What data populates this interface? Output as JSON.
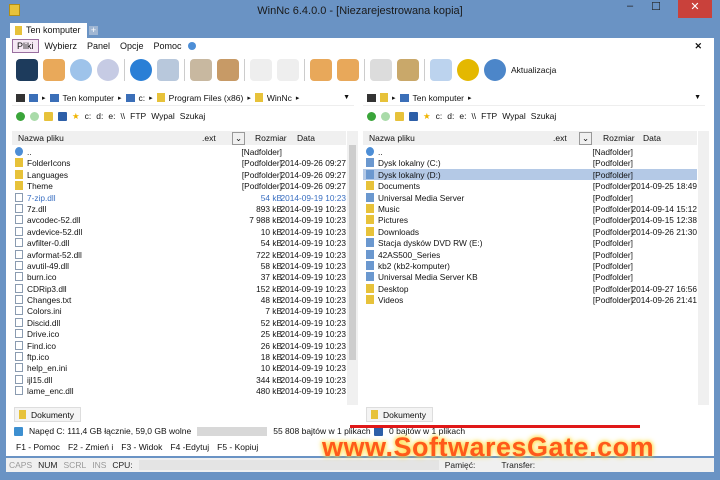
{
  "window": {
    "title": "WinNc 6.4.0.0 - [Niezarejestrowana kopia]",
    "minimize": "–",
    "maximize": "☐",
    "close": "✕"
  },
  "tabs": [
    {
      "label": "Ten komputer"
    }
  ],
  "tab_add": "+",
  "menu": [
    "Pliki",
    "Wybierz",
    "Panel",
    "Opcje",
    "Pomoc"
  ],
  "toolbar": {
    "update_label": "Aktualizacja",
    "close_glyph": "✕"
  },
  "left": {
    "breadcrumb": [
      "Ten komputer",
      "c:",
      "Program Files (x86)",
      "WinNc"
    ],
    "drives": [
      "c:",
      "d:",
      "e:",
      "\\\\",
      "FTP",
      "Wypal",
      "Szukaj"
    ],
    "columns": {
      "name": "Nazwa pliku",
      "ext": ".ext",
      "size": "Rozmiar",
      "date": "Data"
    },
    "rows": [
      {
        "name": "..",
        "size": "[Nadfolder]",
        "date": "",
        "type": "up"
      },
      {
        "name": "FolderIcons",
        "size": "[Podfolder]",
        "date": "2014-09-26 09:27",
        "type": "folder"
      },
      {
        "name": "Languages",
        "size": "[Podfolder]",
        "date": "2014-09-26 09:27",
        "type": "folder"
      },
      {
        "name": "Theme",
        "size": "[Podfolder]",
        "date": "2014-09-26 09:27",
        "type": "folder"
      },
      {
        "name": "7-zip.dll",
        "size": "54 kB",
        "date": "2014-09-19 10:23",
        "type": "file",
        "highlight": true
      },
      {
        "name": "7z.dll",
        "size": "893 kB",
        "date": "2014-09-19 10:23",
        "type": "file"
      },
      {
        "name": "avcodec-52.dll",
        "size": "7 988 kB",
        "date": "2014-09-19 10:23",
        "type": "file"
      },
      {
        "name": "avdevice-52.dll",
        "size": "10 kB",
        "date": "2014-09-19 10:23",
        "type": "file"
      },
      {
        "name": "avfilter-0.dll",
        "size": "54 kB",
        "date": "2014-09-19 10:23",
        "type": "file"
      },
      {
        "name": "avformat-52.dll",
        "size": "722 kB",
        "date": "2014-09-19 10:23",
        "type": "file"
      },
      {
        "name": "avutil-49.dll",
        "size": "58 kB",
        "date": "2014-09-19 10:23",
        "type": "file"
      },
      {
        "name": "burn.ico",
        "size": "37 kB",
        "date": "2014-09-19 10:23",
        "type": "file"
      },
      {
        "name": "CDRip3.dll",
        "size": "152 kB",
        "date": "2014-09-19 10:23",
        "type": "file"
      },
      {
        "name": "Changes.txt",
        "size": "48 kB",
        "date": "2014-09-19 10:23",
        "type": "file"
      },
      {
        "name": "Colors.ini",
        "size": "7 kB",
        "date": "2014-09-19 10:23",
        "type": "file"
      },
      {
        "name": "Discid.dll",
        "size": "52 kB",
        "date": "2014-09-19 10:23",
        "type": "file"
      },
      {
        "name": "Drive.ico",
        "size": "25 kB",
        "date": "2014-09-19 10:23",
        "type": "file"
      },
      {
        "name": "Find.ico",
        "size": "26 kB",
        "date": "2014-09-19 10:23",
        "type": "file"
      },
      {
        "name": "ftp.ico",
        "size": "18 kB",
        "date": "2014-09-19 10:23",
        "type": "file"
      },
      {
        "name": "help_en.ini",
        "size": "10 kB",
        "date": "2014-09-19 10:23",
        "type": "file"
      },
      {
        "name": "ijl15.dll",
        "size": "344 kB",
        "date": "2014-09-19 10:23",
        "type": "file"
      },
      {
        "name": "lame_enc.dll",
        "size": "480 kB",
        "date": "2014-09-19 10:23",
        "type": "file"
      }
    ],
    "bottom_tab": "Dokumenty",
    "status_drive": "Napęd C: 111,4 GB łącznie, 59,0 GB wolne",
    "status_files": "55 808 bajtów w 1 plikach"
  },
  "right": {
    "breadcrumb": [
      "Ten komputer"
    ],
    "drives": [
      "c:",
      "d:",
      "e:",
      "\\\\",
      "FTP",
      "Wypal",
      "Szukaj"
    ],
    "columns": {
      "name": "Nazwa pliku",
      "ext": ".ext",
      "size": "Rozmiar",
      "date": "Data"
    },
    "rows": [
      {
        "name": "..",
        "size": "[Nadfolder]",
        "date": "",
        "type": "up"
      },
      {
        "name": "Dysk lokalny (C:)",
        "size": "[Podfolder]",
        "date": "",
        "type": "drive"
      },
      {
        "name": "Dysk lokalny (D:)",
        "size": "[Podfolder]",
        "date": "",
        "type": "drive",
        "selected": true
      },
      {
        "name": "Documents",
        "size": "[Podfolder]",
        "date": "2014-09-25 18:49",
        "type": "folder"
      },
      {
        "name": "Universal Media Server",
        "size": "[Podfolder]",
        "date": "",
        "type": "drive"
      },
      {
        "name": "Music",
        "size": "[Podfolder]",
        "date": "2014-09-14 15:12",
        "type": "folder"
      },
      {
        "name": "Pictures",
        "size": "[Podfolder]",
        "date": "2014-09-15 12:38",
        "type": "folder"
      },
      {
        "name": "Downloads",
        "size": "[Podfolder]",
        "date": "2014-09-26 21:30",
        "type": "folder"
      },
      {
        "name": "Stacja dysków DVD RW (E:)",
        "size": "[Podfolder]",
        "date": "",
        "type": "drive"
      },
      {
        "name": "42AS500_Series",
        "size": "[Podfolder]",
        "date": "",
        "type": "drive"
      },
      {
        "name": "kb2 (kb2-komputer)",
        "size": "[Podfolder]",
        "date": "",
        "type": "drive"
      },
      {
        "name": "Universal Media Server KB",
        "size": "[Podfolder]",
        "date": "",
        "type": "drive"
      },
      {
        "name": "Desktop",
        "size": "[Podfolder]",
        "date": "2014-09-27 16:56",
        "type": "folder"
      },
      {
        "name": "Videos",
        "size": "[Podfolder]",
        "date": "2014-09-26 21:41",
        "type": "folder"
      }
    ],
    "bottom_tab": "Dokumenty",
    "status_files": "0 bajtów w 1 plikach"
  },
  "fkeys": [
    "F1 - Pomoc",
    "F2 - Zmień i",
    "F3 - Widok",
    "F4 -Edytuj",
    "F5 - Kopiuj"
  ],
  "statusbar": {
    "caps": "CAPS",
    "num": "NUM",
    "scrl": "SCRL",
    "ins": "INS",
    "cpu": "CPU:",
    "memory": "Pamięć:",
    "transfer": "Transfer:"
  },
  "watermark": "www.SoftwaresGate.com"
}
